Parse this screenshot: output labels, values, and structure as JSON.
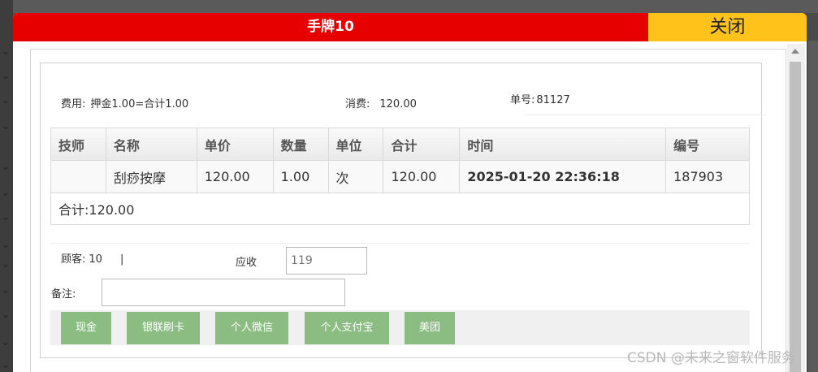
{
  "modal": {
    "title": "手牌10",
    "close_label": "关闭"
  },
  "summary": {
    "fee_label": "费用:",
    "fee_value": "押金1.00=合计1.00",
    "consume_label": "消费:",
    "consume_value": "120.00",
    "order_label": "单号:",
    "order_value": "81127"
  },
  "table": {
    "headers": [
      "技师",
      "名称",
      "单价",
      "数量",
      "单位",
      "合计",
      "时间",
      "编号"
    ],
    "rows": [
      [
        "",
        "刮痧按摩",
        "120.00",
        "1.00",
        "次",
        "120.00",
        "2025-01-20 22:36:18",
        "187903"
      ]
    ],
    "total_label": "合计:",
    "total_value": "120.00"
  },
  "customer": {
    "label": "顾客:",
    "value": "10",
    "divider": "|"
  },
  "receivable": {
    "label": "应收",
    "placeholder": "119"
  },
  "remark": {
    "label": "备注:",
    "value": ""
  },
  "payment_buttons": [
    "现金",
    "银联刷卡",
    "个人微信",
    "个人支付宝",
    "美团"
  ],
  "watermark": "CSDN @未来之窗软件服务",
  "colors": {
    "titlebar": "#e60000",
    "close": "#ffc21a",
    "pay_button": "#8bbd82"
  }
}
